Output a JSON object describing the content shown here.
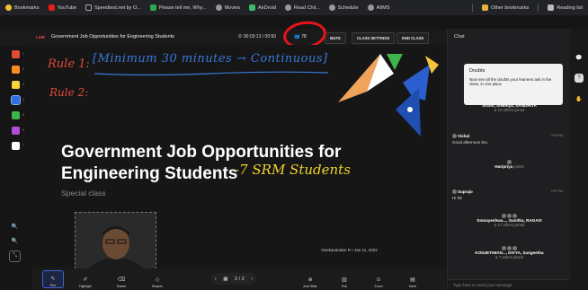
{
  "bookmarks": {
    "items": [
      {
        "label": "Bookmarks",
        "icon": "star-icon",
        "color": "#f4c430"
      },
      {
        "label": "YouTube",
        "icon": "youtube-icon",
        "color": "#e62117"
      },
      {
        "label": "Speedtest.net by O...",
        "icon": "speedtest-icon",
        "color": "#1e1e1e"
      },
      {
        "label": "Please tell me, Why...",
        "icon": "page-icon",
        "color": "#2fa84f"
      },
      {
        "label": "Movies",
        "icon": "globe-icon",
        "color": "#999999"
      },
      {
        "label": "AirDroid",
        "icon": "airdroid-icon",
        "color": "#3dbb6a"
      },
      {
        "label": "Read Chil...",
        "icon": "globe-icon",
        "color": "#999999"
      },
      {
        "label": "Schedule",
        "icon": "globe-icon",
        "color": "#999999"
      },
      {
        "label": "AIIMS",
        "icon": "globe-icon",
        "color": "#999999"
      }
    ],
    "other": "Other bookmarks",
    "reading": "Reading list"
  },
  "topbar": {
    "live": "LIVE",
    "title": "Government Job Opportunities for Engineering Students",
    "timer": "00:03:13 / 00:50",
    "people_count": "78",
    "mute": "MUTE",
    "class_settings": "CLASS SETTINGS",
    "end_class": "END CLASS"
  },
  "colors": {
    "palette": [
      "#e14b36",
      "#ff8a1e",
      "#f7d23a",
      "#2f6fe0",
      "#3db54a",
      "#b04dd6",
      "#ffffff"
    ],
    "accent": "#3b63d9",
    "annotation_red": "#e8141b"
  },
  "board": {
    "rule1_label": "Rule 1:",
    "rule1_text": "[Minimum 30 minutes → Continuous]",
    "rule2_label": "Rule 2:",
    "slide_title_line1": "Government Job Opportunities for",
    "slide_title_line2": "Engineering Students",
    "handwritten": "-7 SRM Students",
    "subtitle": "Special class",
    "presenter": "Vivekanandan R  •  Jan 11, 2022"
  },
  "toolbar": {
    "pen": "Pen",
    "highlight": "Highlight",
    "eraser": "Eraser",
    "shapes": "Shapes",
    "page_current": "2",
    "page_total": "2",
    "add_slide": "Add Slide",
    "poll": "Poll",
    "zoom": "Zoom",
    "more": "More"
  },
  "chat": {
    "title": "Chat",
    "tooltip_title": "Doubts",
    "tooltip_text": "Now see all the doubts your learners ask in the class, in one place",
    "joined1_names": "Vivekanand...",
    "joined1_suffix": "joined",
    "joined2_names": "Sruthi, Sowmya, SANDHIYA",
    "joined2_others": "& 10 others joined",
    "msg1_who": "Vishal",
    "msg1_text": "Good afternoon bro",
    "msg1_time": "2:58 PM",
    "joined3_names": "Haripriya",
    "joined3_suffix": "joined",
    "msg2_who": "Suprajo",
    "msg2_text": "Hi Sir",
    "msg2_time": "2:57 PM",
    "joined4_names": "Somayeshwa..., Sunitha, RAGAVI",
    "joined4_others": "& 17 others joined",
    "joined5_names": "KONJETIMAN..., DIVYA, Sangeetha",
    "joined5_others": "& 7 others joined",
    "input_placeholder": "Type here to send your message"
  }
}
